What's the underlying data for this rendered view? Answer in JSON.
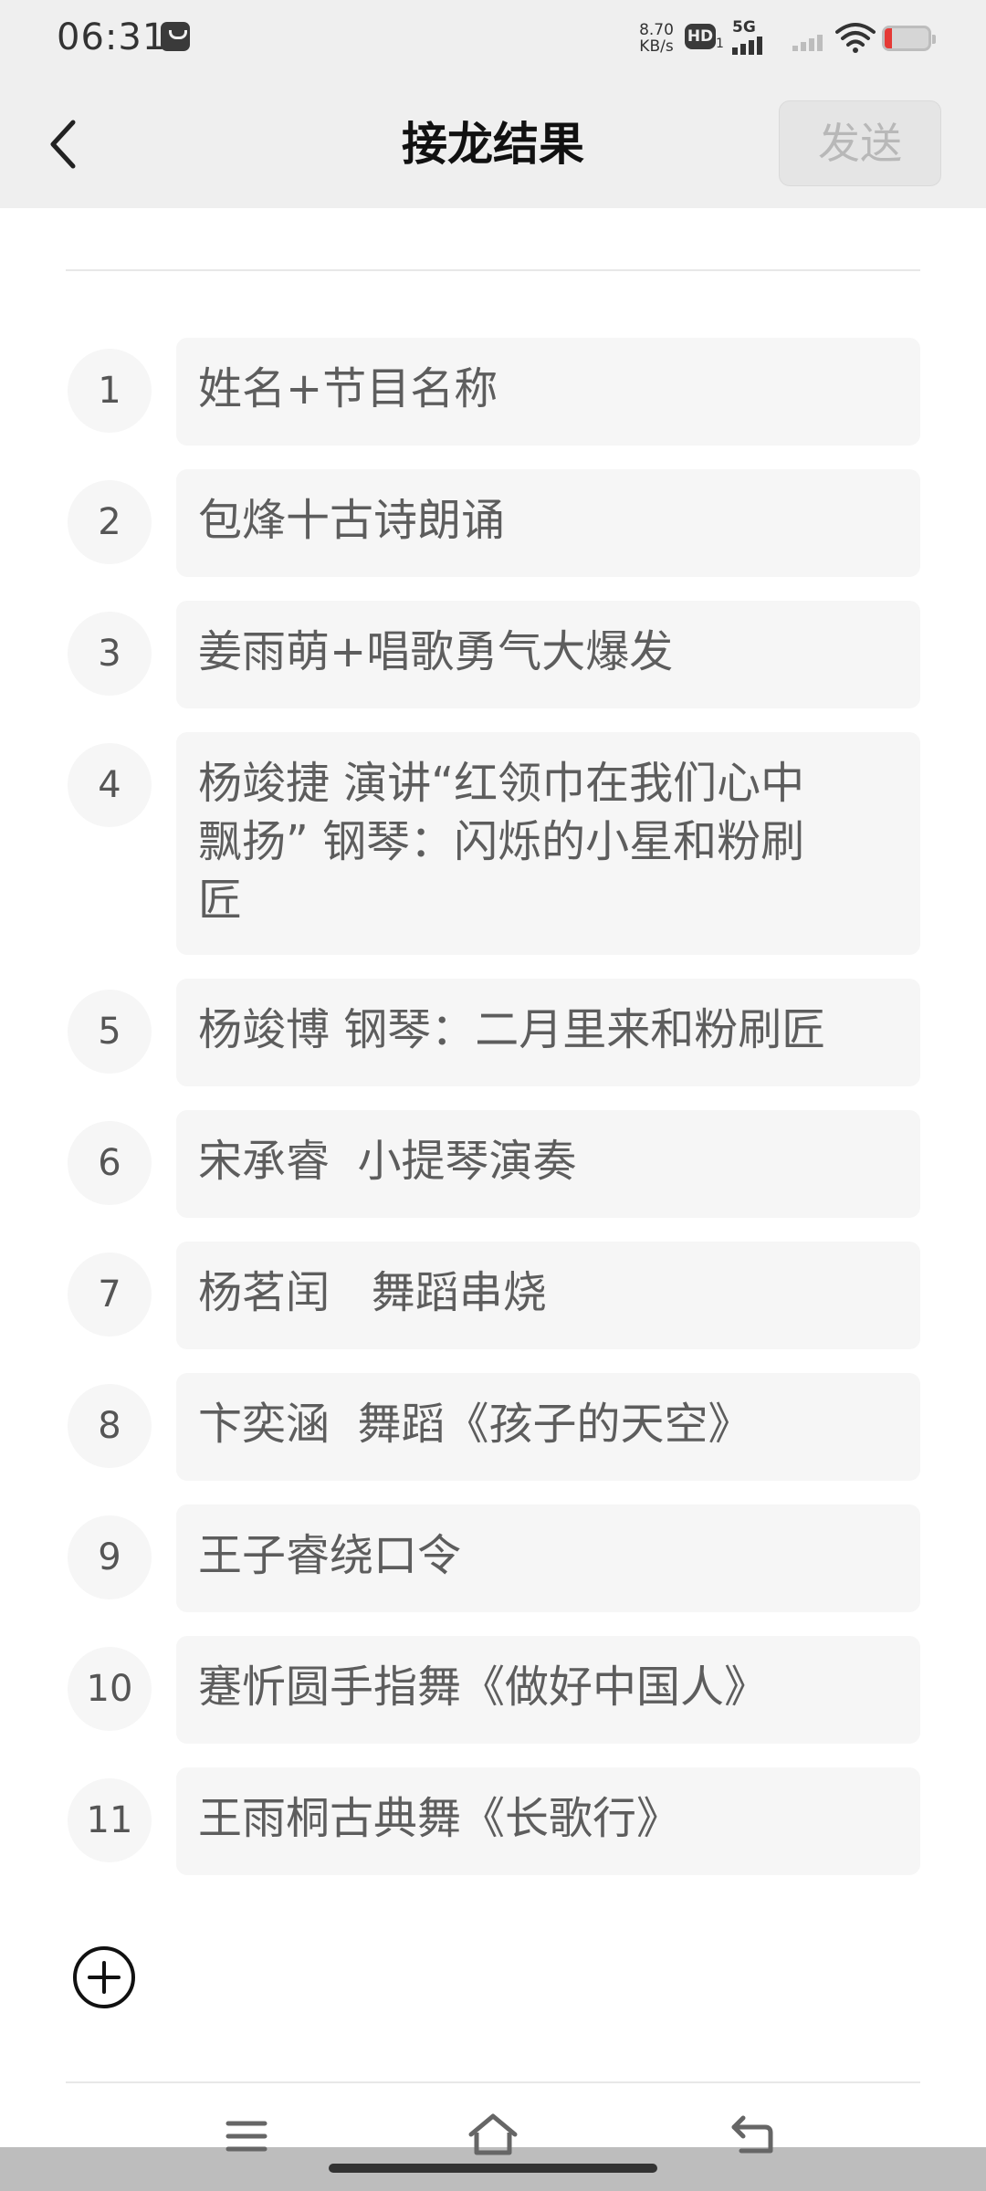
{
  "status_bar": {
    "time": "06:31",
    "net_speed_value": "8.70",
    "net_speed_unit": "KB/s",
    "hd_label": "HD",
    "hd_sub": "1",
    "network_label": "5G"
  },
  "header": {
    "title": "接龙结果",
    "send_label": "发送"
  },
  "entries": [
    {
      "number": "1",
      "text": "姓名+节目名称"
    },
    {
      "number": "2",
      "text": "包烽十古诗朗诵"
    },
    {
      "number": "3",
      "text": "姜雨萌+唱歌勇气大爆发"
    },
    {
      "number": "4",
      "text": "杨竣捷 演讲“红领巾在我们心中\n飘扬” 钢琴：闪烁的小星和粉刷\n匠"
    },
    {
      "number": "5",
      "text": "杨竣博 钢琴：二月里来和粉刷匠"
    },
    {
      "number": "6",
      "text": "宋承睿  小提琴演奏"
    },
    {
      "number": "7",
      "text": "杨茗闰   舞蹈串烧"
    },
    {
      "number": "8",
      "text": "卞奕涵  舞蹈《孩子的天空》"
    },
    {
      "number": "9",
      "text": "王子睿绕口令"
    },
    {
      "number": "10",
      "text": "蹇忻圆手指舞《做好中国人》"
    },
    {
      "number": "11",
      "text": "王雨桐古典舞《长歌行》"
    }
  ],
  "icons": {
    "back": "back-arrow-icon",
    "add": "add-circle-icon",
    "nav_menu": "menu-icon",
    "nav_home": "home-icon",
    "nav_back": "back-icon"
  },
  "colors": {
    "header_bg": "#efefef",
    "entry_bg": "#f6f6f6",
    "entry_text": "#5d5d5d",
    "send_disabled_text": "#b8b8b8"
  }
}
